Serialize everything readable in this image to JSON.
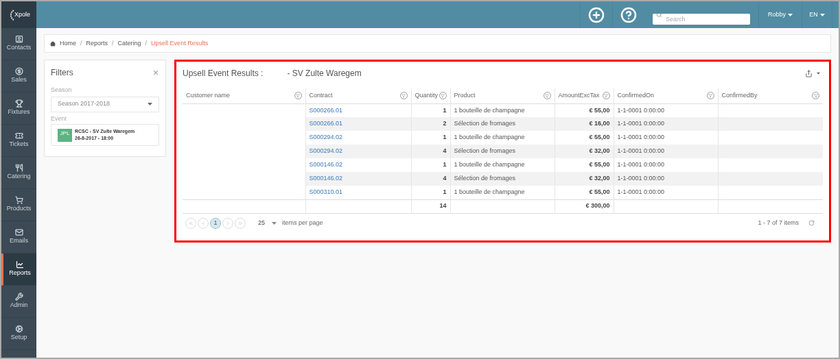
{
  "logo": {
    "text": "Xpole"
  },
  "sidebar": {
    "items": [
      {
        "label": "Contacts",
        "selected": false
      },
      {
        "label": "Sales",
        "selected": false
      },
      {
        "label": "Fixtures",
        "selected": false
      },
      {
        "label": "Tickets",
        "selected": false
      },
      {
        "label": "Catering",
        "selected": false
      },
      {
        "label": "Products",
        "selected": false
      },
      {
        "label": "Emails",
        "selected": false
      },
      {
        "label": "Reports",
        "selected": true
      },
      {
        "label": "Admin",
        "selected": false
      },
      {
        "label": "Setup",
        "selected": false
      }
    ]
  },
  "topbar": {
    "search": {
      "placeholder": "Search"
    },
    "user": "Robby",
    "language": "EN"
  },
  "breadcrumb_separator": "/",
  "breadcrumb": [
    {
      "label": "Home",
      "current": false
    },
    {
      "label": "Reports",
      "current": false
    },
    {
      "label": "Catering",
      "current": false
    },
    {
      "label": "Upsell Event Results",
      "current": true
    }
  ],
  "filters": {
    "title": "Filters",
    "season": {
      "label": "Season",
      "value": "Season 2017-2018"
    },
    "event": {
      "label": "Event",
      "badge": "JPL",
      "name": "RCSC - SV Zulte Waregem",
      "date": "26-8-2017 - 18:00"
    }
  },
  "report": {
    "title": "Upsell Event Results :",
    "subtitle": "- SV Zulte Waregem",
    "highlighted": true,
    "columns": [
      "Customer name",
      "Contract",
      "Quantity",
      "Product",
      "AmountExcTax",
      "ConfirmedOn",
      "ConfirmedBy"
    ],
    "rows": [
      {
        "contract": "S000266.01",
        "quantity": "1",
        "product": "1 bouteille de champagne",
        "amount": "€ 55,00",
        "confirmed_on": "1-1-0001 0:00:00"
      },
      {
        "contract": "S000266.01",
        "quantity": "2",
        "product": "Sélection de fromages",
        "amount": "€ 16,00",
        "confirmed_on": "1-1-0001 0:00:00"
      },
      {
        "contract": "S000294.02",
        "quantity": "1",
        "product": "1 bouteille de champagne",
        "amount": "€ 55,00",
        "confirmed_on": "1-1-0001 0:00:00"
      },
      {
        "contract": "S000294.02",
        "quantity": "4",
        "product": "Sélection de fromages",
        "amount": "€ 32,00",
        "confirmed_on": "1-1-0001 0:00:00"
      },
      {
        "contract": "S000146.02",
        "quantity": "1",
        "product": "1 bouteille de champagne",
        "amount": "€ 55,00",
        "confirmed_on": "1-1-0001 0:00:00"
      },
      {
        "contract": "S000146.02",
        "quantity": "4",
        "product": "Sélection de fromages",
        "amount": "€ 32,00",
        "confirmed_on": "1-1-0001 0:00:00"
      },
      {
        "contract": "S000310.01",
        "quantity": "1",
        "product": "1 bouteille de champagne",
        "amount": "€ 55,00",
        "confirmed_on": "1-1-0001 0:00:00"
      }
    ],
    "totals": {
      "quantity": "14",
      "amount": "€ 300,00"
    },
    "pager": {
      "pages": [
        {
          "label": "1",
          "selected": true
        }
      ],
      "page_size": "25",
      "page_size_label": "items per page",
      "summary": "1 - 7 of 7 items"
    }
  }
}
